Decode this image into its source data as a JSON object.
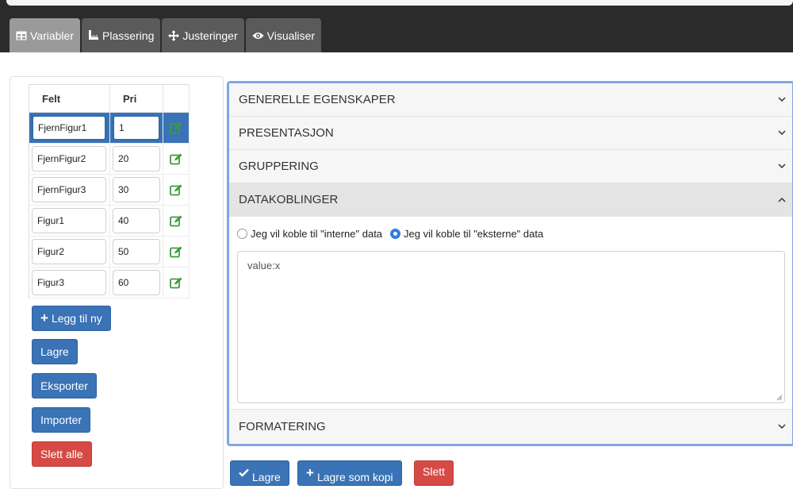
{
  "tabs": [
    {
      "label": "Variabler",
      "icon": "table-icon",
      "active": true
    },
    {
      "label": "Plassering",
      "icon": "ruler-icon",
      "active": false
    },
    {
      "label": "Justeringer",
      "icon": "move-icon",
      "active": false
    },
    {
      "label": "Visualiser",
      "icon": "eye-icon",
      "active": false
    }
  ],
  "variables_table": {
    "headers": [
      "Felt",
      "Pri"
    ],
    "rows": [
      {
        "felt": "FjernFigur1",
        "pri": "1",
        "selected": true
      },
      {
        "felt": "FjernFigur2",
        "pri": "20",
        "selected": false
      },
      {
        "felt": "FjernFigur3",
        "pri": "30",
        "selected": false
      },
      {
        "felt": "Figur1",
        "pri": "40",
        "selected": false
      },
      {
        "felt": "Figur2",
        "pri": "50",
        "selected": false
      },
      {
        "felt": "Figur3",
        "pri": "60",
        "selected": false
      }
    ]
  },
  "left_buttons": {
    "add": "Legg til ny",
    "save": "Lagre",
    "export": "Eksporter",
    "import": "Importer",
    "delete_all": "Slett alle"
  },
  "accordion": {
    "sections": [
      {
        "title": "GENERELLE EGENSKAPER",
        "open": false
      },
      {
        "title": "PRESENTASJON",
        "open": false
      },
      {
        "title": "GRUPPERING",
        "open": false
      },
      {
        "title": "DATAKOBLINGER",
        "open": true
      },
      {
        "title": "FORMATERING",
        "open": false
      }
    ],
    "datakoblinger": {
      "radio_internal": "Jeg vil koble til \"interne\" data",
      "radio_external": "Jeg vil koble til \"eksterne\" data",
      "selected": "external",
      "textarea_value": "value:x"
    }
  },
  "bottom_buttons": {
    "save": "Lagre",
    "save_copy": "Lagre som kopi",
    "delete": "Slett"
  },
  "colors": {
    "primary": "#3a73b6",
    "danger": "#d64a46",
    "edit_icon": "#3d9a3d",
    "accordion_focus": "#7fa6e6"
  }
}
